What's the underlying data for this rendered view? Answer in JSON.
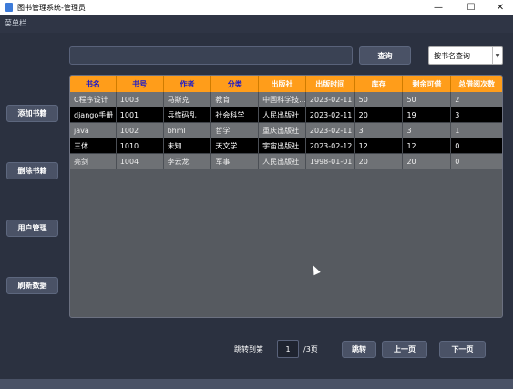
{
  "window": {
    "title": "图书管理系统-管理员",
    "minimize": "—",
    "maximize": "☐",
    "close": "✕"
  },
  "menubar": {
    "label": "菜单栏"
  },
  "search": {
    "value": "",
    "placeholder": "",
    "button": "查询",
    "mode": "按书名查询",
    "mode_chevron": "▼"
  },
  "sidebar": [
    "添加书籍",
    "删除书籍",
    "用户管理",
    "刷新数据"
  ],
  "table": {
    "headers": [
      "书名",
      "书号",
      "作者",
      "分类",
      "出版社",
      "出版时间",
      "库存",
      "剩余可借",
      "总借阅次数"
    ],
    "header_colors": [
      "#1a1acc",
      "#1a1acc",
      "#1a1acc",
      "#1a1acc",
      "#ffffff",
      "#ffffff",
      "#ffffff",
      "#ffffff",
      "#ffffff"
    ],
    "header_bg": "#ff9d1a",
    "rows": [
      [
        "C程序设计",
        "1003",
        "马斯克",
        "教育",
        "中国科学技…",
        "2023-02-11",
        "50",
        "50",
        "2"
      ],
      [
        "django手册",
        "1001",
        "兵慌码乱",
        "社会科学",
        "人民出版社",
        "2023-02-11",
        "20",
        "19",
        "3"
      ],
      [
        "java",
        "1002",
        "bhml",
        "哲学",
        "重庆出版社",
        "2023-02-11",
        "3",
        "3",
        "1"
      ],
      [
        "三体",
        "1010",
        "未知",
        "天文学",
        "宇宙出版社",
        "2023-02-12",
        "12",
        "12",
        "0"
      ],
      [
        "亮剑",
        "1004",
        "李云龙",
        "军事",
        "人民出版社",
        "1998-01-01",
        "20",
        "20",
        "0"
      ]
    ]
  },
  "pager": {
    "jump_label": "跳转到第",
    "page": "1",
    "total": "/3页",
    "jump_button": "跳转",
    "prev": "上一页",
    "next": "下一页"
  }
}
